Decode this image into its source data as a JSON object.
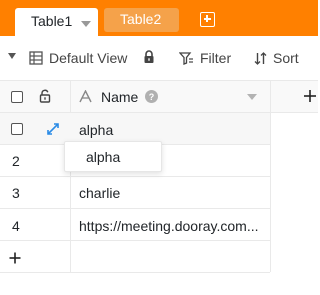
{
  "tabs": [
    {
      "label": "Table1",
      "active": true
    },
    {
      "label": "Table2",
      "active": false
    }
  ],
  "toolbar": {
    "view_label": "Default View",
    "filter_label": "Filter",
    "sort_label": "Sort"
  },
  "header": {
    "column_name": "Name"
  },
  "rows": [
    {
      "num": "",
      "name": "alpha"
    },
    {
      "num": "2",
      "name": ""
    },
    {
      "num": "3",
      "name": "charlie"
    },
    {
      "num": "4",
      "name": "https://meeting.dooray.com..."
    }
  ],
  "dropdown": {
    "option": "alpha"
  },
  "colors": {
    "brand": "#ff8000",
    "inactive_tab": "#f5a24a",
    "expand_icon": "#2a8be6"
  }
}
